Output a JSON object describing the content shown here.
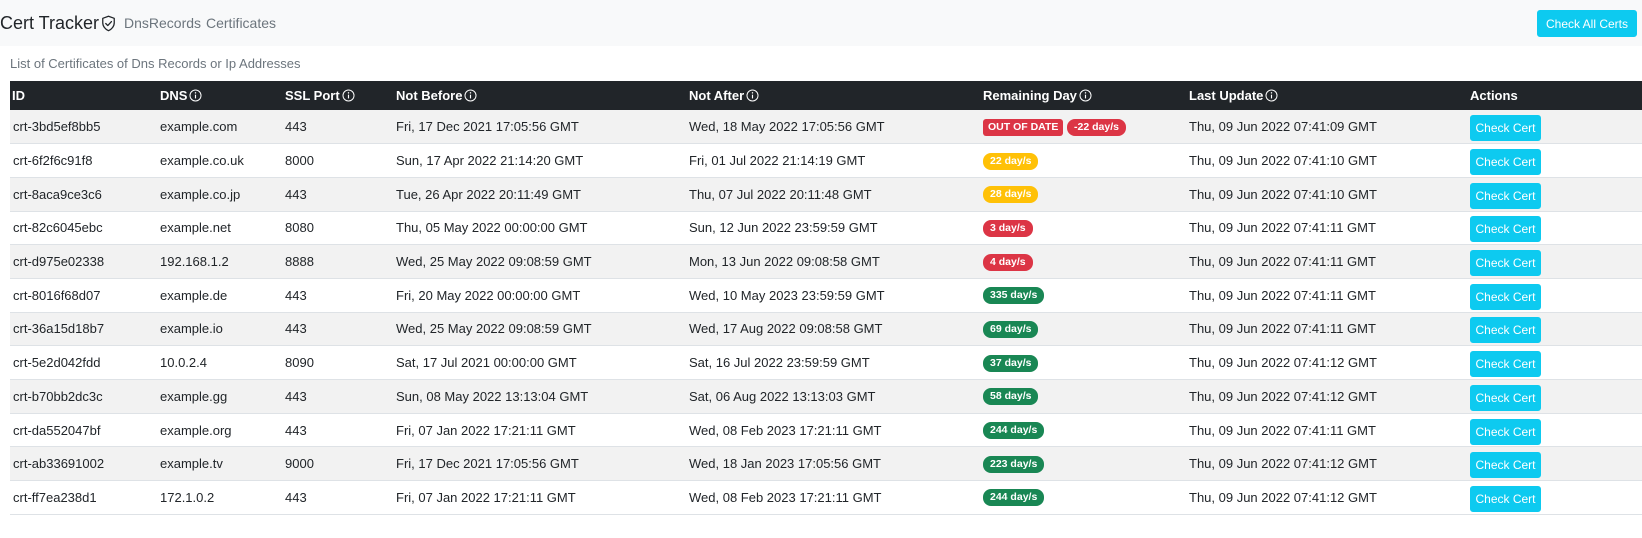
{
  "app": {
    "brand": "Cert Tracker",
    "nav": [
      "DnsRecords",
      "Certificates"
    ],
    "check_all_label": "Check All Certs"
  },
  "caption": "List of Certificates of Dns Records or Ip Addresses",
  "table": {
    "headers": {
      "id": "ID",
      "dns": "DNS",
      "port": "SSL Port",
      "not_before": "Not Before",
      "not_after": "Not After",
      "remaining": "Remaining Day",
      "last_update": "Last Update",
      "actions": "Actions"
    },
    "action_label": "Check Cert",
    "status_colors": {
      "danger": "#dc3545",
      "warning": "#ffc107",
      "success": "#198754"
    },
    "rows": [
      {
        "id": "crt-3bd5ef8bb5",
        "dns": "example.com",
        "port": "443",
        "not_before": "Fri, 17 Dec 2021 17:05:56 GMT",
        "not_after": "Wed, 18 May 2022 17:05:56 GMT",
        "out_of_date": "OUT OF DATE",
        "remaining": "-22 day/s",
        "status": "danger",
        "last_update": "Thu, 09 Jun 2022 07:41:09 GMT"
      },
      {
        "id": "crt-6f2f6c91f8",
        "dns": "example.co.uk",
        "port": "8000",
        "not_before": "Sun, 17 Apr 2022 21:14:20 GMT",
        "not_after": "Fri, 01 Jul 2022 21:14:19 GMT",
        "remaining": "22 day/s",
        "status": "warning",
        "last_update": "Thu, 09 Jun 2022 07:41:10 GMT"
      },
      {
        "id": "crt-8aca9ce3c6",
        "dns": "example.co.jp",
        "port": "443",
        "not_before": "Tue, 26 Apr 2022 20:11:49 GMT",
        "not_after": "Thu, 07 Jul 2022 20:11:48 GMT",
        "remaining": "28 day/s",
        "status": "warning",
        "last_update": "Thu, 09 Jun 2022 07:41:10 GMT"
      },
      {
        "id": "crt-82c6045ebc",
        "dns": "example.net",
        "port": "8080",
        "not_before": "Thu, 05 May 2022 00:00:00 GMT",
        "not_after": "Sun, 12 Jun 2022 23:59:59 GMT",
        "remaining": "3 day/s",
        "status": "danger",
        "last_update": "Thu, 09 Jun 2022 07:41:11 GMT"
      },
      {
        "id": "crt-d975e02338",
        "dns": "192.168.1.2",
        "port": "8888",
        "not_before": "Wed, 25 May 2022 09:08:59 GMT",
        "not_after": "Mon, 13 Jun 2022 09:08:58 GMT",
        "remaining": "4 day/s",
        "status": "danger",
        "last_update": "Thu, 09 Jun 2022 07:41:11 GMT"
      },
      {
        "id": "crt-8016f68d07",
        "dns": "example.de",
        "port": "443",
        "not_before": "Fri, 20 May 2022 00:00:00 GMT",
        "not_after": "Wed, 10 May 2023 23:59:59 GMT",
        "remaining": "335 day/s",
        "status": "success",
        "last_update": "Thu, 09 Jun 2022 07:41:11 GMT"
      },
      {
        "id": "crt-36a15d18b7",
        "dns": "example.io",
        "port": "443",
        "not_before": "Wed, 25 May 2022 09:08:59 GMT",
        "not_after": "Wed, 17 Aug 2022 09:08:58 GMT",
        "remaining": "69 day/s",
        "status": "success",
        "last_update": "Thu, 09 Jun 2022 07:41:11 GMT"
      },
      {
        "id": "crt-5e2d042fdd",
        "dns": "10.0.2.4",
        "port": "8090",
        "not_before": "Sat, 17 Jul 2021 00:00:00 GMT",
        "not_after": "Sat, 16 Jul 2022 23:59:59 GMT",
        "remaining": "37 day/s",
        "status": "success",
        "last_update": "Thu, 09 Jun 2022 07:41:12 GMT"
      },
      {
        "id": "crt-b70bb2dc3c",
        "dns": "example.gg",
        "port": "443",
        "not_before": "Sun, 08 May 2022 13:13:04 GMT",
        "not_after": "Sat, 06 Aug 2022 13:13:03 GMT",
        "remaining": "58 day/s",
        "status": "success",
        "last_update": "Thu, 09 Jun 2022 07:41:12 GMT"
      },
      {
        "id": "crt-da552047bf",
        "dns": "example.org",
        "port": "443",
        "not_before": "Fri, 07 Jan 2022 17:21:11 GMT",
        "not_after": "Wed, 08 Feb 2023 17:21:11 GMT",
        "remaining": "244 day/s",
        "status": "success",
        "last_update": "Thu, 09 Jun 2022 07:41:11 GMT"
      },
      {
        "id": "crt-ab33691002",
        "dns": "example.tv",
        "port": "9000",
        "not_before": "Fri, 17 Dec 2021 17:05:56 GMT",
        "not_after": "Wed, 18 Jan 2023 17:05:56 GMT",
        "remaining": "223 day/s",
        "status": "success",
        "last_update": "Thu, 09 Jun 2022 07:41:12 GMT"
      },
      {
        "id": "crt-ff7ea238d1",
        "dns": "172.1.0.2",
        "port": "443",
        "not_before": "Fri, 07 Jan 2022 17:21:11 GMT",
        "not_after": "Wed, 08 Feb 2023 17:21:11 GMT",
        "remaining": "244 day/s",
        "status": "success",
        "last_update": "Thu, 09 Jun 2022 07:41:12 GMT"
      }
    ]
  }
}
